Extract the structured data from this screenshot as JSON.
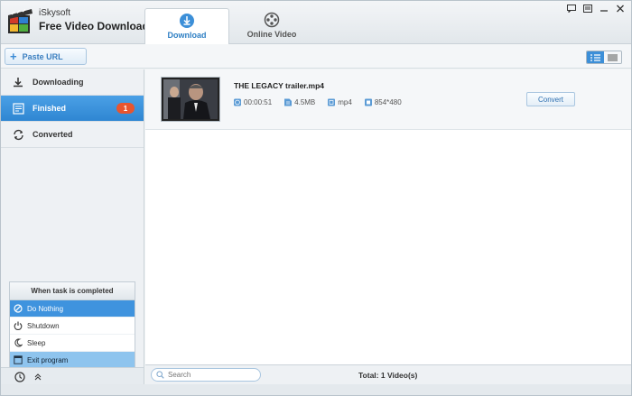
{
  "app": {
    "brand_small": "iSkysoft",
    "brand_big": "Free Video Downloader"
  },
  "tabs": [
    {
      "label": "Download",
      "icon": "download-circle-icon",
      "active": true
    },
    {
      "label": "Online Video",
      "icon": "film-reel-icon",
      "active": false
    }
  ],
  "window_buttons": [
    "chat-icon",
    "menu-icon",
    "minimize-icon",
    "close-icon"
  ],
  "toolbar": {
    "paste_label": "Paste URL",
    "view_modes": [
      "list-detail-icon",
      "list-compact-icon"
    ]
  },
  "sidebar": {
    "items": [
      {
        "label": "Downloading",
        "icon": "download-arrow-icon",
        "active": false
      },
      {
        "label": "Finished",
        "icon": "finished-list-icon",
        "active": true,
        "badge": "1"
      },
      {
        "label": "Converted",
        "icon": "convert-icon",
        "active": false
      }
    ],
    "completion": {
      "title": "When task is completed",
      "options": [
        {
          "label": "Do Nothing",
          "icon": "prohibited-icon",
          "state": "selected"
        },
        {
          "label": "Shutdown",
          "icon": "power-icon",
          "state": "normal"
        },
        {
          "label": "Sleep",
          "icon": "moon-icon",
          "state": "normal"
        },
        {
          "label": "Exit program",
          "icon": "exit-icon",
          "state": "hover"
        }
      ]
    },
    "footer_icons": [
      "clock-icon",
      "chevron-up-icon"
    ]
  },
  "video": {
    "filename": "THE LEGACY trailer.mp4",
    "duration": "00:00:51",
    "size": "4.5MB",
    "format": "mp4",
    "resolution": "854*480",
    "convert_label": "Convert"
  },
  "status": {
    "search_placeholder": "Search",
    "total": "Total: 1 Video(s)"
  },
  "colors": {
    "accent": "#3c8fd8",
    "badge": "#e8552f"
  }
}
